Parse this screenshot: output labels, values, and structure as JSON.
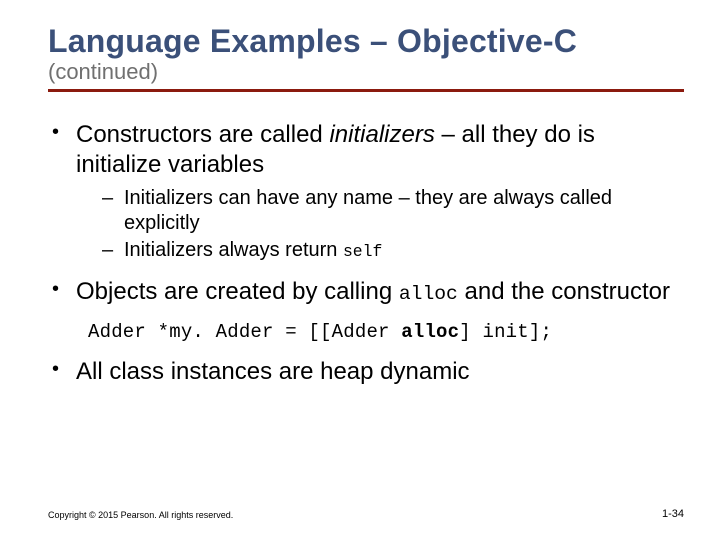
{
  "title": "Language Examples – Objective-C",
  "subtitle": "(continued)",
  "bullets": {
    "b1_pre": "Constructors are called ",
    "b1_em": "initializers",
    "b1_post": " – all they do is initialize variables",
    "b1_sub1": "Initializers can have any name – they are always called explicitly",
    "b1_sub2_pre": "Initializers always return ",
    "b1_sub2_code": "self",
    "b2_pre": "Objects are created by calling ",
    "b2_code": "alloc",
    "b2_post": " and the constructor",
    "code_line_a": "Adder *my. Adder = [[Adder ",
    "code_line_b": "alloc",
    "code_line_c": "] init];",
    "b3": "All class instances are heap dynamic"
  },
  "footer": "Copyright © 2015 Pearson. All rights reserved.",
  "pagenum": "1-34"
}
